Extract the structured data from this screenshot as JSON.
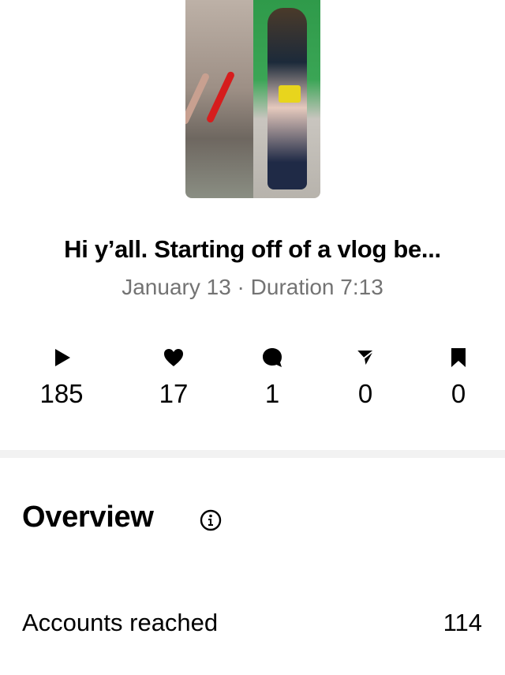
{
  "post": {
    "thumbnail": "video-thumbnail",
    "caption": "Hi y’all. Starting off of a vlog be...",
    "meta": "January 13 · Duration 7:13"
  },
  "stats": [
    {
      "icon": "play-icon",
      "value": "185"
    },
    {
      "icon": "heart-icon",
      "value": "17"
    },
    {
      "icon": "comment-icon",
      "value": "1"
    },
    {
      "icon": "share-icon",
      "value": "0"
    },
    {
      "icon": "bookmark-icon",
      "value": "0"
    }
  ],
  "overview": {
    "heading": "Overview",
    "info_icon": "info-icon",
    "rows": [
      {
        "label": "Accounts reached",
        "value": "114"
      }
    ]
  }
}
